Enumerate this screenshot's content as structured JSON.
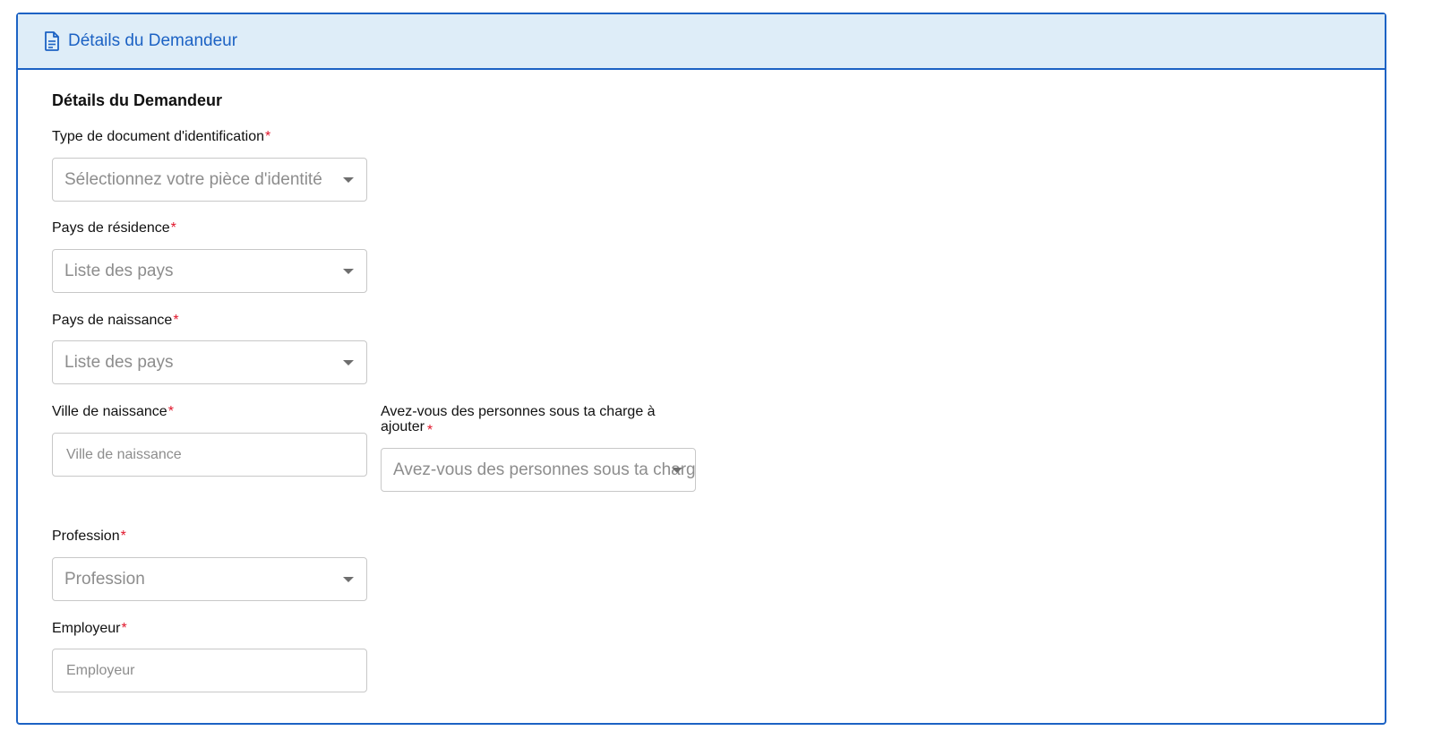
{
  "panel": {
    "header_title": "Détails du Demandeur",
    "header_icon": "document-icon",
    "accent_color": "#1c62c4",
    "header_bg": "#deedf8"
  },
  "section": {
    "title": "Détails du Demandeur"
  },
  "fields": {
    "id_type": {
      "label": "Type de document d'identification",
      "required": "*",
      "placeholder": "Sélectionnez votre pièce d'identité"
    },
    "residence_country": {
      "label": "Pays de résidence",
      "required": "*",
      "placeholder": "Liste des pays"
    },
    "birth_country": {
      "label": "Pays de naissance",
      "required": "*",
      "placeholder": "Liste des pays"
    },
    "birth_city": {
      "label": "Ville de naissance",
      "required": "*",
      "placeholder": "Ville de naissance"
    },
    "dependents": {
      "label": "Avez-vous des personnes sous ta charge à ajouter",
      "required": "*",
      "placeholder": "Avez-vous des personnes sous ta charge à ajouter"
    },
    "profession": {
      "label": "Profession",
      "required": "*",
      "placeholder": "Profession"
    },
    "employer": {
      "label": "Employeur",
      "required": "*",
      "placeholder": "Employeur"
    }
  }
}
